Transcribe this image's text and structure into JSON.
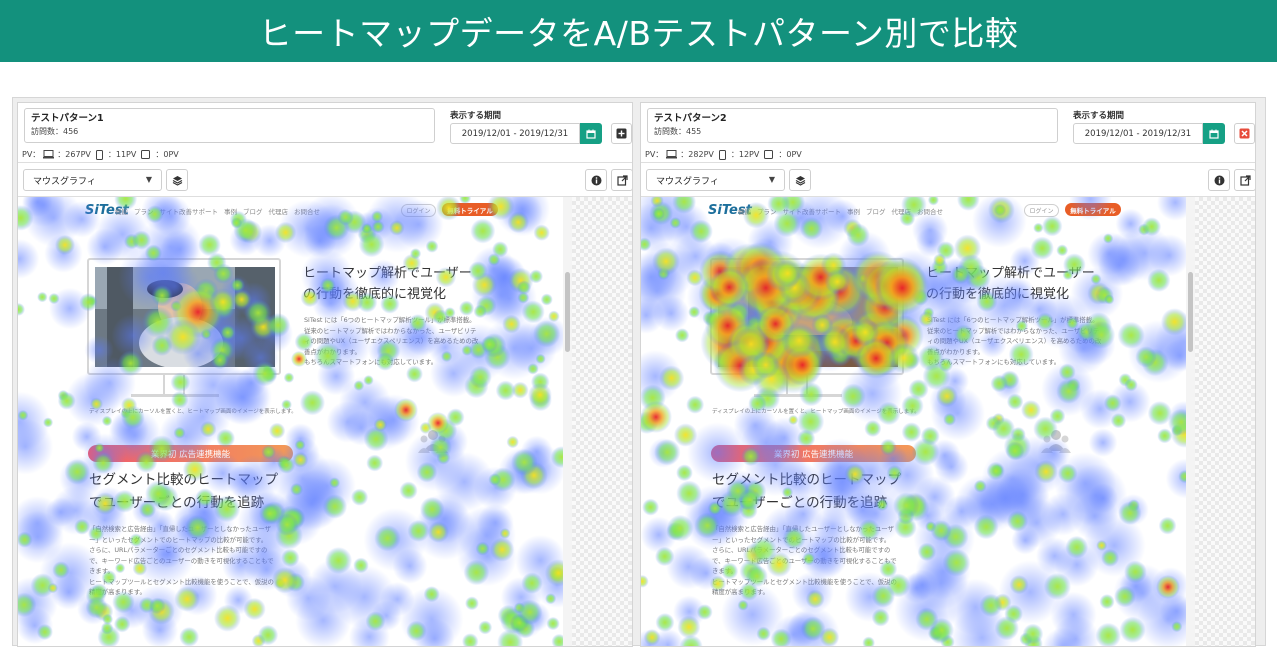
{
  "banner": {
    "title": "ヒートマップデータをA/Bテストパターン別で比較"
  },
  "panels": [
    {
      "pattern_name": "テストパターン1",
      "visits": "訪問数：456",
      "period_label": "表示する期間",
      "date_range": "2019/12/01 - 2019/12/31",
      "side_action": "add",
      "pv_label": "PV：",
      "pv_desktop": "：267PV",
      "pv_tablet": "：11PV",
      "pv_mobile": "：0PV",
      "view_mode": "マウスグラフィ",
      "photo_subject": "baby"
    },
    {
      "pattern_name": "テストパターン2",
      "visits": "訪問数：455",
      "period_label": "表示する期間",
      "date_range": "2019/12/01 - 2019/12/31",
      "side_action": "remove",
      "pv_label": "PV：",
      "pv_desktop": "：282PV",
      "pv_tablet": "：12PV",
      "pv_mobile": "：0PV",
      "view_mode": "マウスグラフィ",
      "photo_subject": "cat"
    }
  ],
  "site": {
    "logo": "SiTest",
    "nav": [
      "機能",
      "プラン",
      "サイト改善サポート",
      "事例",
      "ブログ",
      "代理店",
      "お問合せ"
    ],
    "login": "ログイン",
    "trial": "無料トライアル",
    "hero_title": [
      "ヒートマップ解析でユーザー",
      "の行動を徹底的に視覚化"
    ],
    "hero_body": [
      "SiTest には「6つのヒートマップ解析ツール」が標準搭載。",
      "従来のヒートマップ解析ではわからなかった、ユーザビリテ",
      "ィの問題やUX（ユーザエクスペリエンス）を高めるための改",
      "善点がわかります。",
      "もちろんスマートフォンにも対応しています。"
    ],
    "caption": "ディスプレイの上にカーソルを置くと、ヒートマップ画面のイメージを表示します。",
    "badge": "業界初 広告連携機能",
    "section_title": [
      "セグメント比較のヒートマップ",
      "でユーザーごとの行動を追跡"
    ],
    "section_body": [
      "「自然検索と広告経由」「直帰したユーザーとしなかったユーザ",
      "ー」といったセグメントでのヒートマップの比較が可能です。",
      "さらに、URLパラメーターごとのセグメント比較も可能ですの",
      "で、キーワード広告ごとのユーザーの動きを可視化することもで",
      "きます。",
      "ヒートマップツールとセグメント比較機能を使うことで、仮説の",
      "精度が高まります。"
    ]
  },
  "colors": {
    "banner": "#13917d",
    "calendar_button": "#16a085",
    "remove_button": "#e74c3c",
    "trial_button": "#e85d26",
    "logo": "#1d6f9c"
  }
}
